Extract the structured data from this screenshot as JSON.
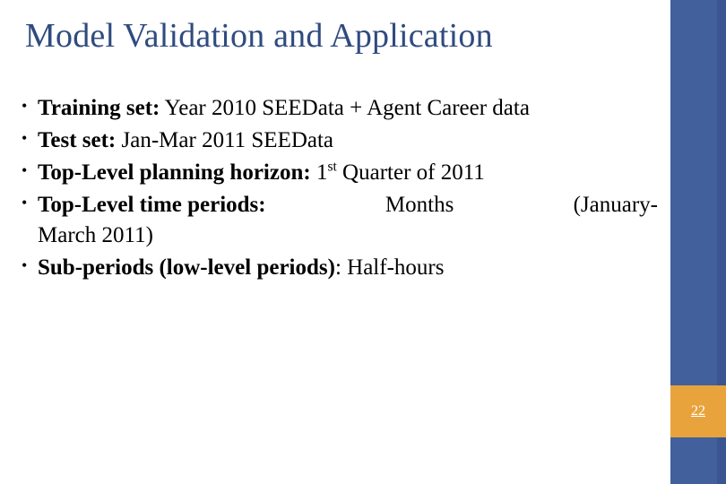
{
  "slide": {
    "title": "Model Validation and Application",
    "page_number": "22",
    "colors": {
      "title_blue": "#2f4b7f",
      "band_blue": "#42609b",
      "page_box_orange": "#e8a33d"
    },
    "bullets": [
      {
        "marker": "•",
        "label": "Training set:",
        "text": " Year 2010 SEEData + Agent Career data"
      },
      {
        "marker": "•",
        "label": "Test set:",
        "text": " Jan-Mar 2011 SEEData"
      },
      {
        "marker": "•",
        "label": "Top-Level planning horizon:",
        "text_pre": " 1",
        "superscript": "st",
        "text_post": " Quarter of 2011"
      },
      {
        "marker": "•",
        "label": "Top-Level time periods:",
        "text_line1": "Months",
        "text_line2": "(January-",
        "text_line3": "March 2011)"
      },
      {
        "marker": "•",
        "label": "Sub-periods (low-level periods)",
        "text": ": Half-hours"
      }
    ]
  }
}
